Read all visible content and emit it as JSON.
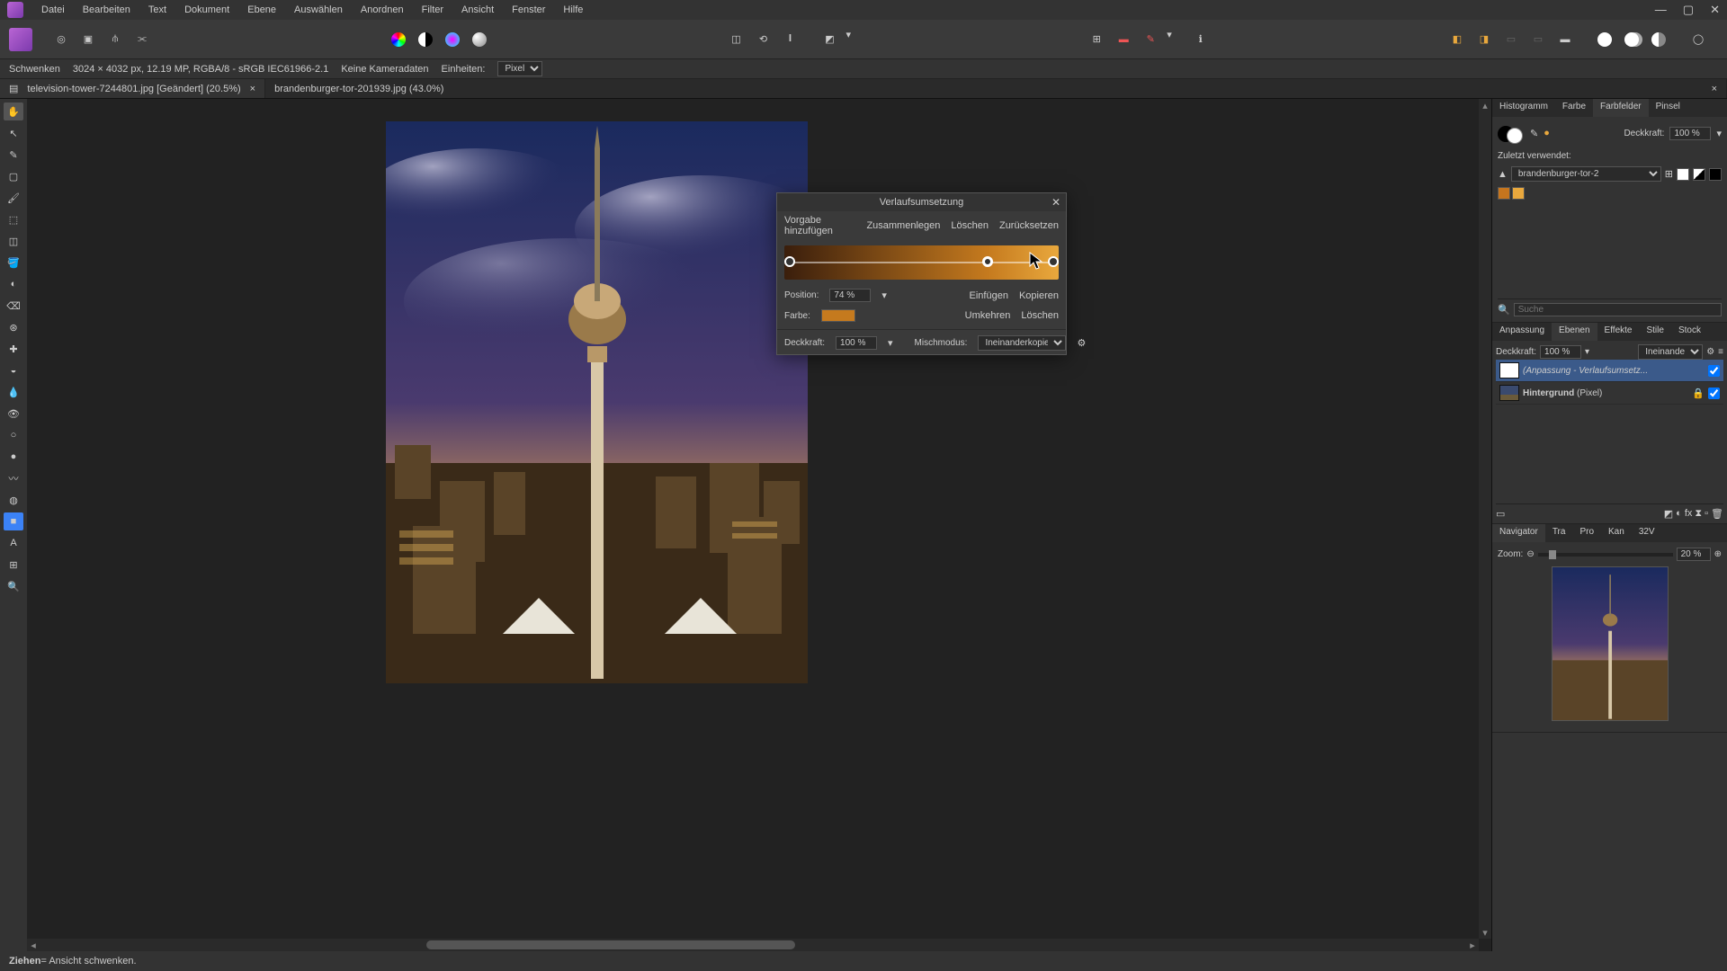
{
  "menubar": {
    "items": [
      "Datei",
      "Bearbeiten",
      "Text",
      "Dokument",
      "Ebene",
      "Auswählen",
      "Anordnen",
      "Filter",
      "Ansicht",
      "Fenster",
      "Hilfe"
    ]
  },
  "context": {
    "tool": "Schwenken",
    "info": "3024 × 4032 px, 12.19 MP, RGBA/8 - sRGB IEC61966-2.1",
    "camera": "Keine Kameradaten",
    "units_label": "Einheiten:",
    "units_value": "Pixel"
  },
  "tabs": [
    {
      "label": "television-tower-7244801.jpg [Geändert] (20.5%)",
      "active": true
    },
    {
      "label": "brandenburger-tor-201939.jpg (43.0%)",
      "active": false
    }
  ],
  "dialog": {
    "title": "Verlaufsumsetzung",
    "add_preset": "Vorgabe hinzufügen",
    "merge": "Zusammenlegen",
    "delete": "Löschen",
    "reset": "Zurücksetzen",
    "position_label": "Position:",
    "position_value": "74 %",
    "color_label": "Farbe:",
    "insert": "Einfügen",
    "copy": "Kopieren",
    "reverse": "Umkehren",
    "delete2": "Löschen",
    "opacity_label": "Deckkraft:",
    "opacity_value": "100 %",
    "blend_label": "Mischmodus:",
    "blend_value": "Ineinanderkopieren"
  },
  "panels": {
    "top_tabs": [
      "Histogramm",
      "Farbe",
      "Farbfelder",
      "Pinsel"
    ],
    "top_active": "Farbfelder",
    "opacity_label": "Deckkraft:",
    "opacity_value": "100 %",
    "recent_label": "Zuletzt verwendet:",
    "preset_name": "brandenburger-tor-2",
    "search_placeholder": "Suche",
    "mid_tabs": [
      "Anpassung",
      "Ebenen",
      "Effekte",
      "Stile",
      "Stock"
    ],
    "mid_active": "Ebenen",
    "layer_opacity_label": "Deckkraft:",
    "layer_opacity_value": "100 %",
    "layer_blend": "Ineinanderko",
    "layer1": "(Anpassung - Verlaufsumsetz...",
    "layer2_name": "Hintergrund",
    "layer2_type": "(Pixel)",
    "bottom_tabs": [
      "Navigator",
      "Tra",
      "Pro",
      "Kan",
      "32V"
    ],
    "bottom_active": "Navigator",
    "zoom_label": "Zoom:",
    "zoom_value": "20 %"
  },
  "status": {
    "hint_bold": "Ziehen",
    "hint_rest": " = Ansicht schwenken."
  }
}
